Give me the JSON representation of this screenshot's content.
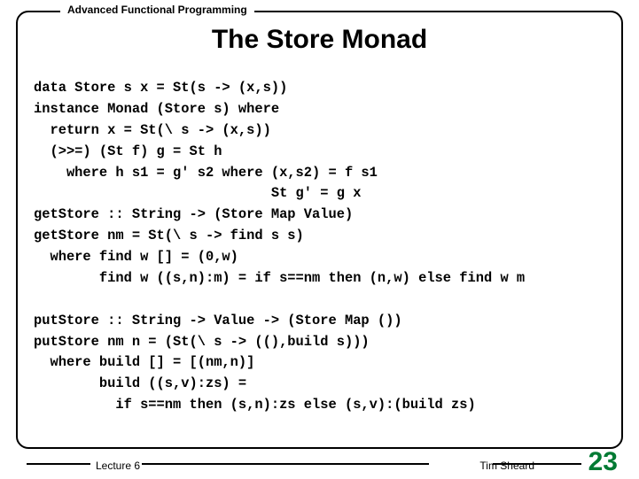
{
  "header": "Advanced Functional Programming",
  "title": "The Store Monad",
  "code": "data Store s x = St(s -> (x,s))\ninstance Monad (Store s) where\n  return x = St(\\ s -> (x,s))\n  (>>=) (St f) g = St h\n    where h s1 = g' s2 where (x,s2) = f s1\n                             St g' = g x\ngetStore :: String -> (Store Map Value)\ngetStore nm = St(\\ s -> find s s)\n  where find w [] = (0,w)\n        find w ((s,n):m) = if s==nm then (n,w) else find w m\n\nputStore :: String -> Value -> (Store Map ())\nputStore nm n = (St(\\ s -> ((),build s)))\n  where build [] = [(nm,n)]\n        build ((s,v):zs) =\n          if s==nm then (s,n):zs else (s,v):(build zs)",
  "footer": {
    "left": "Lecture 6",
    "right": "Tim Sheard",
    "page": "23"
  }
}
